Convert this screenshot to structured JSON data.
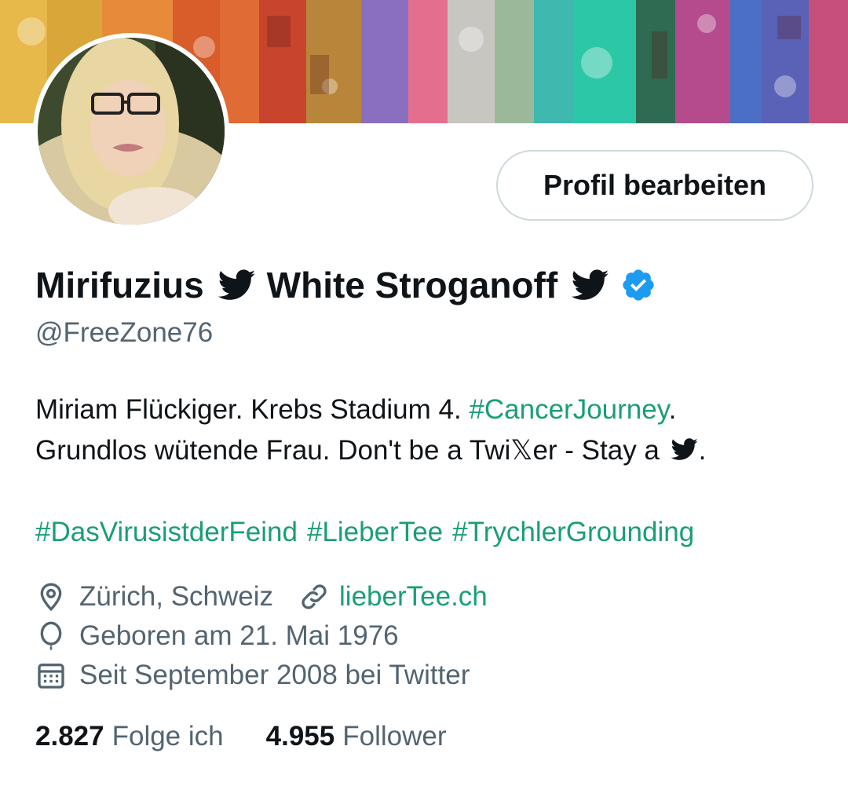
{
  "profile": {
    "edit_button_label": "Profil bearbeiten",
    "display_name_part1": "Mirifuzius",
    "display_name_part2": "White Stroganoff",
    "handle": "@FreeZone76",
    "bio": {
      "line1_text": "Miriam Flückiger. Krebs Stadium 4. ",
      "line1_hashtag": "#CancerJourney",
      "line1_end": ".",
      "line2_text": "Grundlos wütende Frau.  Don't be a Twi𝕏er - Stay a ",
      "line2_end": ".",
      "hashtags": [
        "#DasVirusistderFeind",
        "#LieberTee",
        "#TrychlerGrounding"
      ]
    },
    "location": "Zürich, Schweiz",
    "website": "lieberTee.ch",
    "birthday": "Geboren am 21. Mai 1976",
    "joined": "Seit September 2008 bei Twitter",
    "following_count": "2.827",
    "following_label": "Folge ich",
    "followers_count": "4.955",
    "followers_label": "Follower"
  },
  "icons": {
    "bird": "twitter-bird-icon",
    "verified": "verified-badge-icon",
    "location": "location-pin-icon",
    "link": "link-icon",
    "birthday": "balloon-icon",
    "joined": "calendar-icon"
  },
  "colors": {
    "accent": "#1a9e77",
    "text_primary": "#0f1419",
    "text_secondary": "#536471",
    "verified": "#1d9bf0",
    "button_border": "#cfd9de"
  }
}
